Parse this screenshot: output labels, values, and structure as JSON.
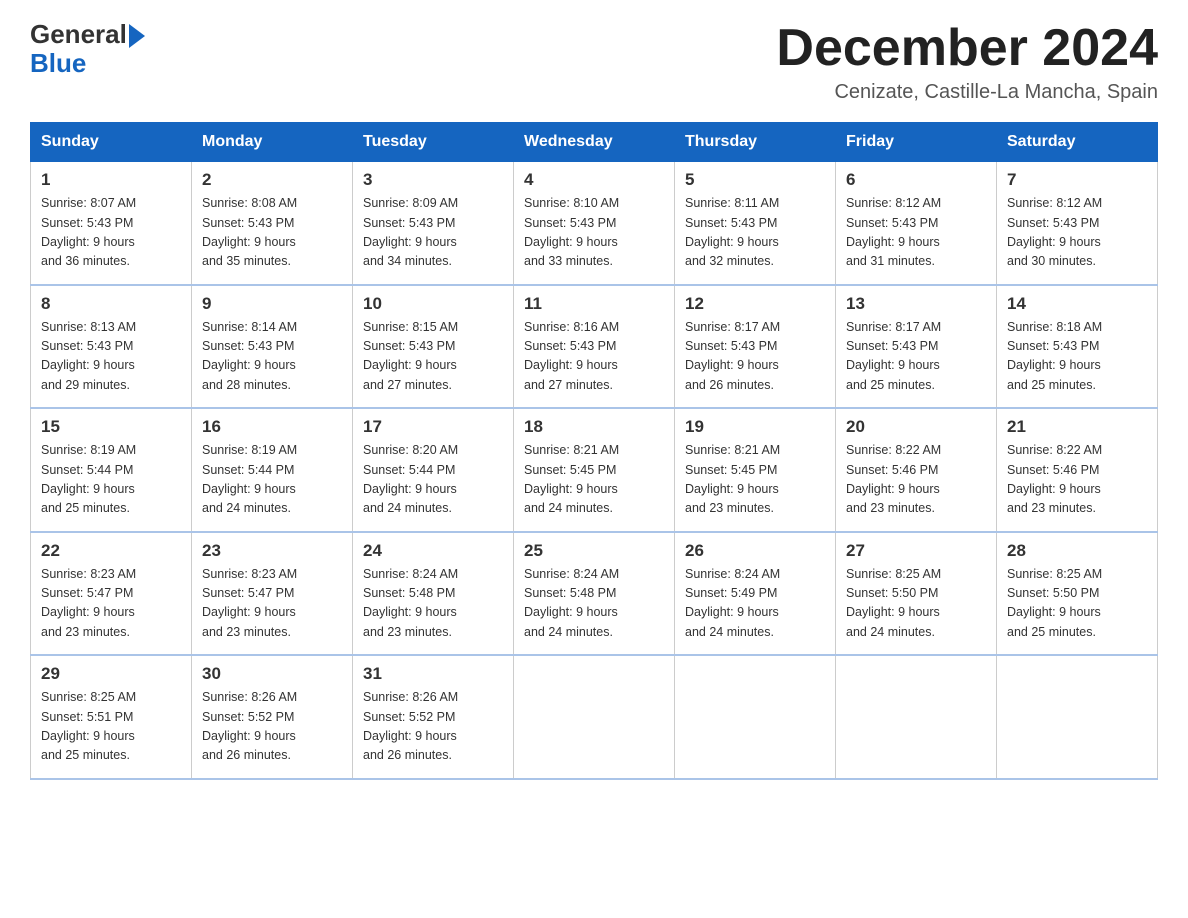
{
  "header": {
    "logo_text_general": "General",
    "logo_text_blue": "Blue",
    "month_title": "December 2024",
    "subtitle": "Cenizate, Castille-La Mancha, Spain"
  },
  "weekdays": [
    "Sunday",
    "Monday",
    "Tuesday",
    "Wednesday",
    "Thursday",
    "Friday",
    "Saturday"
  ],
  "weeks": [
    [
      {
        "day": "1",
        "sunrise": "8:07 AM",
        "sunset": "5:43 PM",
        "daylight": "9 hours and 36 minutes."
      },
      {
        "day": "2",
        "sunrise": "8:08 AM",
        "sunset": "5:43 PM",
        "daylight": "9 hours and 35 minutes."
      },
      {
        "day": "3",
        "sunrise": "8:09 AM",
        "sunset": "5:43 PM",
        "daylight": "9 hours and 34 minutes."
      },
      {
        "day": "4",
        "sunrise": "8:10 AM",
        "sunset": "5:43 PM",
        "daylight": "9 hours and 33 minutes."
      },
      {
        "day": "5",
        "sunrise": "8:11 AM",
        "sunset": "5:43 PM",
        "daylight": "9 hours and 32 minutes."
      },
      {
        "day": "6",
        "sunrise": "8:12 AM",
        "sunset": "5:43 PM",
        "daylight": "9 hours and 31 minutes."
      },
      {
        "day": "7",
        "sunrise": "8:12 AM",
        "sunset": "5:43 PM",
        "daylight": "9 hours and 30 minutes."
      }
    ],
    [
      {
        "day": "8",
        "sunrise": "8:13 AM",
        "sunset": "5:43 PM",
        "daylight": "9 hours and 29 minutes."
      },
      {
        "day": "9",
        "sunrise": "8:14 AM",
        "sunset": "5:43 PM",
        "daylight": "9 hours and 28 minutes."
      },
      {
        "day": "10",
        "sunrise": "8:15 AM",
        "sunset": "5:43 PM",
        "daylight": "9 hours and 27 minutes."
      },
      {
        "day": "11",
        "sunrise": "8:16 AM",
        "sunset": "5:43 PM",
        "daylight": "9 hours and 27 minutes."
      },
      {
        "day": "12",
        "sunrise": "8:17 AM",
        "sunset": "5:43 PM",
        "daylight": "9 hours and 26 minutes."
      },
      {
        "day": "13",
        "sunrise": "8:17 AM",
        "sunset": "5:43 PM",
        "daylight": "9 hours and 25 minutes."
      },
      {
        "day": "14",
        "sunrise": "8:18 AM",
        "sunset": "5:43 PM",
        "daylight": "9 hours and 25 minutes."
      }
    ],
    [
      {
        "day": "15",
        "sunrise": "8:19 AM",
        "sunset": "5:44 PM",
        "daylight": "9 hours and 25 minutes."
      },
      {
        "day": "16",
        "sunrise": "8:19 AM",
        "sunset": "5:44 PM",
        "daylight": "9 hours and 24 minutes."
      },
      {
        "day": "17",
        "sunrise": "8:20 AM",
        "sunset": "5:44 PM",
        "daylight": "9 hours and 24 minutes."
      },
      {
        "day": "18",
        "sunrise": "8:21 AM",
        "sunset": "5:45 PM",
        "daylight": "9 hours and 24 minutes."
      },
      {
        "day": "19",
        "sunrise": "8:21 AM",
        "sunset": "5:45 PM",
        "daylight": "9 hours and 23 minutes."
      },
      {
        "day": "20",
        "sunrise": "8:22 AM",
        "sunset": "5:46 PM",
        "daylight": "9 hours and 23 minutes."
      },
      {
        "day": "21",
        "sunrise": "8:22 AM",
        "sunset": "5:46 PM",
        "daylight": "9 hours and 23 minutes."
      }
    ],
    [
      {
        "day": "22",
        "sunrise": "8:23 AM",
        "sunset": "5:47 PM",
        "daylight": "9 hours and 23 minutes."
      },
      {
        "day": "23",
        "sunrise": "8:23 AM",
        "sunset": "5:47 PM",
        "daylight": "9 hours and 23 minutes."
      },
      {
        "day": "24",
        "sunrise": "8:24 AM",
        "sunset": "5:48 PM",
        "daylight": "9 hours and 23 minutes."
      },
      {
        "day": "25",
        "sunrise": "8:24 AM",
        "sunset": "5:48 PM",
        "daylight": "9 hours and 24 minutes."
      },
      {
        "day": "26",
        "sunrise": "8:24 AM",
        "sunset": "5:49 PM",
        "daylight": "9 hours and 24 minutes."
      },
      {
        "day": "27",
        "sunrise": "8:25 AM",
        "sunset": "5:50 PM",
        "daylight": "9 hours and 24 minutes."
      },
      {
        "day": "28",
        "sunrise": "8:25 AM",
        "sunset": "5:50 PM",
        "daylight": "9 hours and 25 minutes."
      }
    ],
    [
      {
        "day": "29",
        "sunrise": "8:25 AM",
        "sunset": "5:51 PM",
        "daylight": "9 hours and 25 minutes."
      },
      {
        "day": "30",
        "sunrise": "8:26 AM",
        "sunset": "5:52 PM",
        "daylight": "9 hours and 26 minutes."
      },
      {
        "day": "31",
        "sunrise": "8:26 AM",
        "sunset": "5:52 PM",
        "daylight": "9 hours and 26 minutes."
      },
      null,
      null,
      null,
      null
    ]
  ]
}
